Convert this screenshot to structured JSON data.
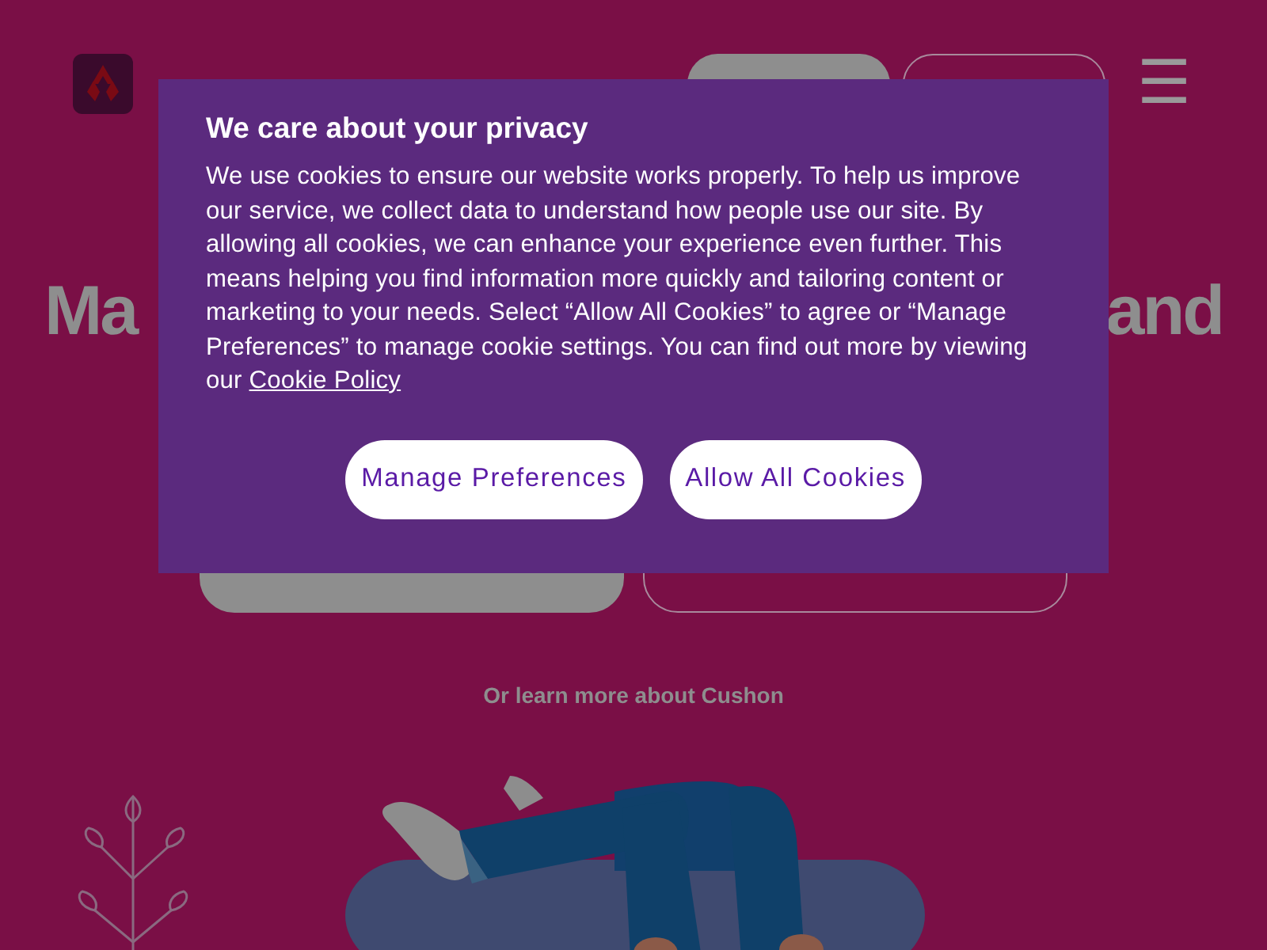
{
  "header": {
    "menu": "☰"
  },
  "hero": {
    "title_left": "Ma",
    "title_right": "and",
    "more_link": "Or learn more about Cushon"
  },
  "cookie_dialog": {
    "title": "We care about your privacy",
    "body": "We use cookies to ensure our website works properly. To help us improve our service, we collect data to understand how people use our site. By allowing all cookies, we can enhance your experience even further. This means helping you find information more quickly and tailoring content or marketing to your needs. Select “Allow All Cookies” to agree or “Manage Preferences” to manage cookie settings. You can find out more by viewing our",
    "link": "Cookie Policy",
    "buttons": [
      "Manage Preferences",
      "Allow All Cookies"
    ]
  }
}
